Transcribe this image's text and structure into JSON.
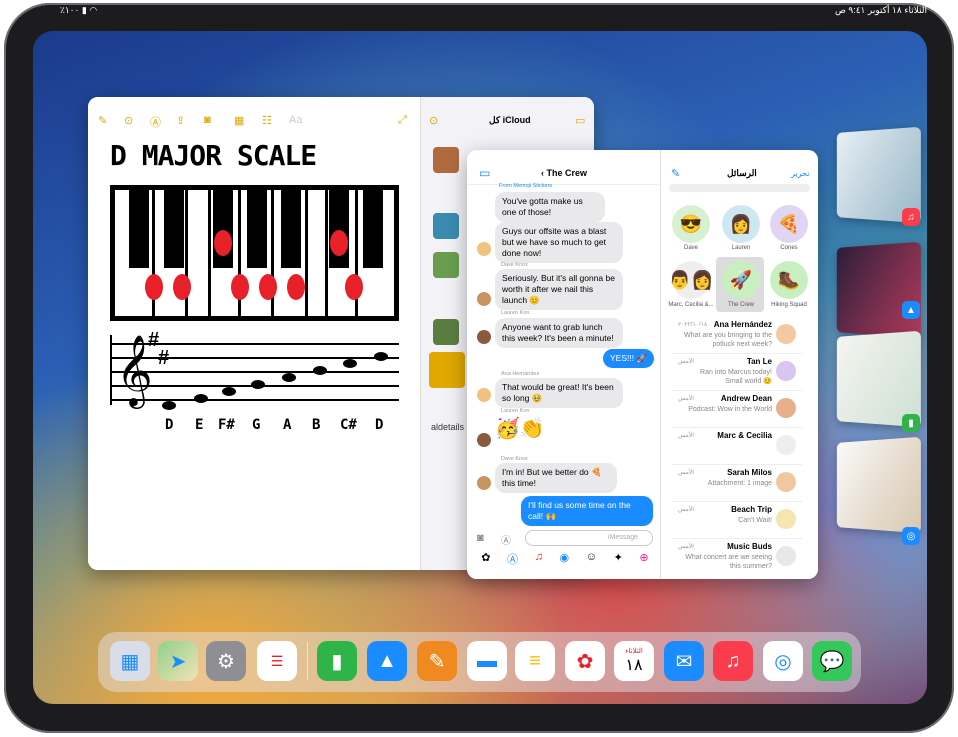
{
  "status": {
    "time": "٩:٤١ ص",
    "date": "الثلاثاء ١٨ أكتوبر",
    "battery": "٪١٠٠"
  },
  "notes": {
    "title": "D MAJOR SCALE",
    "note_names": [
      "D",
      "E",
      "F#",
      "G",
      "A",
      "B",
      "C#",
      "D"
    ],
    "side_title": "كل iCloud",
    "side_item": "aldetails",
    "font_btn": "Aa"
  },
  "messages_chat": {
    "title": "The Crew",
    "from_label": "From Memoji Stickers",
    "messages": [
      {
        "sender": "",
        "text": "You've gotta make us one of those!"
      },
      {
        "sender": "",
        "text": "Guys our offsite was a blast but we have so much to get done now!"
      },
      {
        "sender": "Dave Knox",
        "text": "Seriously. But it's all gonna be worth it after we nail this launch 😊"
      },
      {
        "sender": "Lauren Kon",
        "text": "Anyone want to grab lunch this week? It's been a minute!"
      },
      {
        "sender": "",
        "text": "YES!!! 🚀"
      },
      {
        "sender": "Ana Hernández",
        "text": "That would be great! It's been so long 🥹"
      },
      {
        "sender": "Lauren Kon",
        "text": "🥳👏"
      },
      {
        "sender": "Dave Knox",
        "text": "I'm in! But we better do 🍕 this time!"
      },
      {
        "sender": "",
        "text": "I'll find us some time on the call! 🙌"
      }
    ],
    "input_placeholder": "iMessage"
  },
  "messages_list": {
    "title": "الرسائل",
    "edit": "تحرير",
    "pinned": [
      {
        "name": "Dave",
        "emoji": "😎"
      },
      {
        "name": "Lauren",
        "emoji": "👩"
      },
      {
        "name": "Cones",
        "emoji": "🍕"
      },
      {
        "name": "Marc, Cecilia &...",
        "emoji": "👨‍👩"
      },
      {
        "name": "The Crew",
        "emoji": "🚀"
      },
      {
        "name": "Hiking Squad",
        "emoji": "🥾"
      }
    ],
    "conversations": [
      {
        "name": "Ana Hernández",
        "preview": "What are you bringing to the potluck next week?",
        "time": "٢٠٢٢/١٠/١٨"
      },
      {
        "name": "Tan Le",
        "preview": "Ran into Marcus today! Small world 😊",
        "time": "الأمس"
      },
      {
        "name": "Andrew Dean",
        "preview": "Podcast: Wow in the World",
        "time": "الأمس"
      },
      {
        "name": "Marc & Cecilia",
        "preview": "",
        "time": "الأمس"
      },
      {
        "name": "Sarah Milos",
        "preview": "Attachment: 1 image",
        "time": "الأمس"
      },
      {
        "name": "Beach Trip",
        "preview": "Can't Wait!",
        "time": "الأمس"
      },
      {
        "name": "Music Buds",
        "preview": "What concert are we seeing this summer?",
        "time": "الأمس"
      }
    ]
  },
  "dock": {
    "apps": [
      "App Library",
      "Maps",
      "Settings",
      "Reminders",
      "Numbers",
      "Keynote",
      "Pages",
      "Files",
      "Notes",
      "Photos",
      "Calendar",
      "Mail",
      "Music",
      "Safari",
      "Messages"
    ],
    "calendar_day": "الثلاثاء",
    "calendar_date": "١٨"
  }
}
